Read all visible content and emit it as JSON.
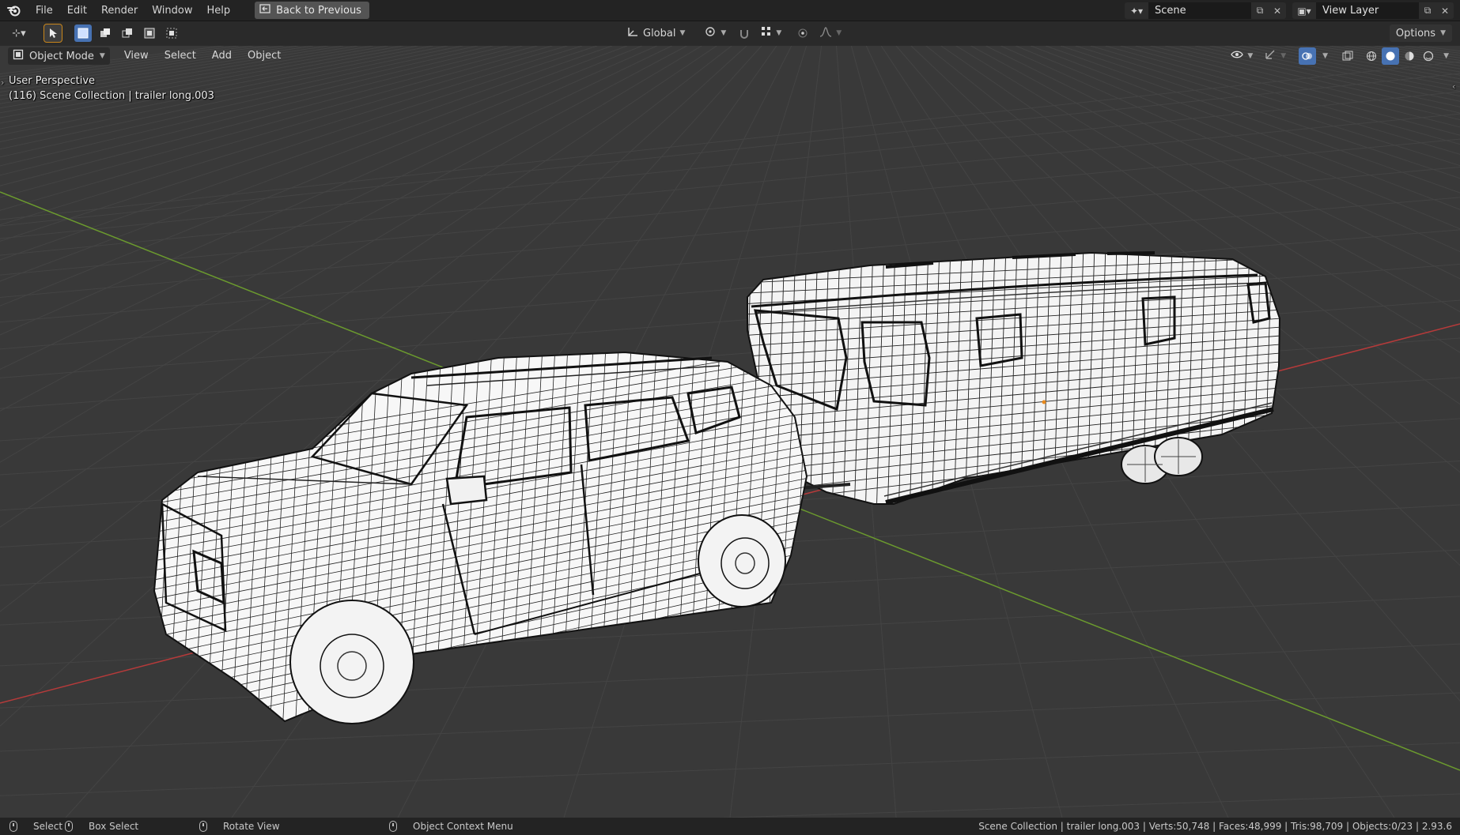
{
  "app": {
    "logo": "blender-logo-icon",
    "menu": [
      "File",
      "Edit",
      "Render",
      "Window",
      "Help"
    ],
    "back_button": "Back to Previous",
    "scene_name": "Scene",
    "view_layer": "View Layer"
  },
  "toolbar": {
    "transform_orientation": "Global",
    "options_label": "Options"
  },
  "viewport_header": {
    "mode": "Object Mode",
    "menus": [
      "View",
      "Select",
      "Add",
      "Object"
    ]
  },
  "viewport": {
    "perspective_label": "User Perspective",
    "collection_label": "(116) Scene Collection | trailer long.003",
    "background": "#393939",
    "x_axis_color": "#b53a3a",
    "y_axis_color": "#6b9a2e",
    "objects": [
      "suv-wireframe",
      "trailer-wireframe"
    ]
  },
  "statusbar": {
    "select": "Select",
    "box_select": "Box Select",
    "rotate_view": "Rotate View",
    "context_menu": "Object Context Menu",
    "stats": "Scene Collection | trailer long.003 | Verts:50,748 | Faces:48,999 | Tris:98,709 | Objects:0/23 | 2.93.6"
  }
}
